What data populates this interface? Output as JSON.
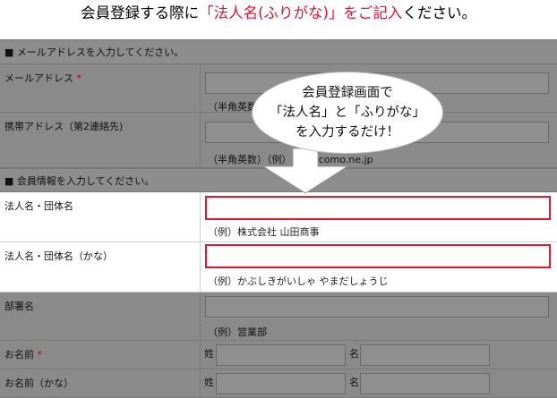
{
  "headline": {
    "before": "会員登録する際に",
    "highlight": "「法人名(ふりがな)」をご記入",
    "after": "ください。"
  },
  "sections": {
    "email": "■ メールアドレスを入力してください。",
    "member": "■ 会員情報を入力してください。"
  },
  "fields": {
    "email": {
      "label": "メールアドレス",
      "required_mark": "*",
      "hint": "（半角英数）"
    },
    "mobile": {
      "label": "携帯アドレス（第2連絡先)",
      "hint": "（半角英数）（例）",
      "hint_tail": "...docomo.ne.jp"
    },
    "corp_name": {
      "label": "法人名・団体名",
      "hint": "（例）株式会社 山田商事"
    },
    "corp_kana": {
      "label": "法人名・団体名（かな）",
      "hint": "（例）かぶしきがいしゃ やまだしょうじ"
    },
    "department": {
      "label": "部署名",
      "hint": "（例）営業部"
    },
    "name": {
      "label": "お名前",
      "required_mark": "*",
      "last": "姓",
      "first": "名"
    },
    "name_kana": {
      "label": "お名前（かな）",
      "last": "姓",
      "first": "名"
    }
  },
  "callout": {
    "line1": "会員登録画面で",
    "line2": "「法人名」と「ふりがな」",
    "line3": "を入力するだけ！"
  },
  "colors": {
    "highlight_red": "#e8112d",
    "dim_gray": "#8a8a8a",
    "callout_arrow": "#ffffff"
  }
}
